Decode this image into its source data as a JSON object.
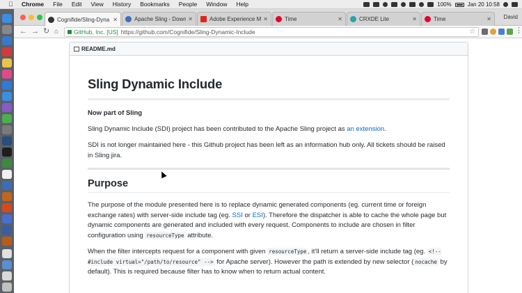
{
  "menubar": {
    "app_name": "Chrome",
    "items": [
      "File",
      "Edit",
      "View",
      "History",
      "Bookmarks",
      "People",
      "Window",
      "Help"
    ],
    "battery": "100%",
    "clock": "Jan 20  10:58"
  },
  "browser": {
    "tabs": [
      {
        "title": "Cognifide/Sling-Dyna",
        "favicon": "github-icon",
        "color": "#333333",
        "active": true
      },
      {
        "title": "Apache Sling - Downl",
        "favicon": "sling-icon",
        "color": "#3d6fb6",
        "active": false
      },
      {
        "title": "Adobe Experience Ma",
        "favicon": "adobe-icon",
        "color": "#e1251b",
        "active": false
      },
      {
        "title": "Time",
        "favicon": "aem-icon",
        "color": "#e3002b",
        "active": false
      },
      {
        "title": "CRXDE Lite",
        "favicon": "crxde-icon",
        "color": "#2aa4a8",
        "active": false
      },
      {
        "title": "Time",
        "favicon": "aem-icon",
        "color": "#e3002b",
        "active": false
      }
    ],
    "close_glyph": "✕",
    "profile_name": "David",
    "address": {
      "cert": "GitHub, Inc. [US]",
      "url": "https://github.com/Cognifide/Sling-Dynamic-Include"
    }
  },
  "readme": {
    "filename": "README.md",
    "title": "Sling Dynamic Include",
    "now_part_heading": "Now part of Sling",
    "intro": {
      "before": "Sling Dynamic Include (SDI) project has been contributed to the Apache Sling project as ",
      "link": "an extension",
      "after": "."
    },
    "maintenance": "SDI is not longer maintained here - this Github project has been left as an information hub only. All tickets should be raised in Sling jira.",
    "purpose_heading": "Purpose",
    "purpose": {
      "t1": "The purpose of the module presented here is to replace dynamic generated components (eg. current time or foreign exchange rates) with server-side include tag (eg. ",
      "link_ssi": "SSI",
      "t2": " or ",
      "link_esi": "ESI",
      "t3": "). Therefore the dispatcher is able to cache the whole page but dynamic components are generated and included with every request. Components to include are chosen in filter configuration using ",
      "code1": "resourceType",
      "t4": " attribute."
    },
    "filter": {
      "t1": "When the filter intercepts request for a component with given ",
      "code1": "resourceType",
      "t2": ", it'll return a server-side include tag (eg. ",
      "code2": "<!--#include virtual=\"/path/to/resource\" -->",
      "t3": " for Apache server). However the path is extended by new selector (",
      "code3": "nocache",
      "t4": " by default). This is required because filter has to know when to return actual content."
    }
  },
  "colors": {
    "link": "#0366d6",
    "cert_green": "#1e8e3e"
  }
}
